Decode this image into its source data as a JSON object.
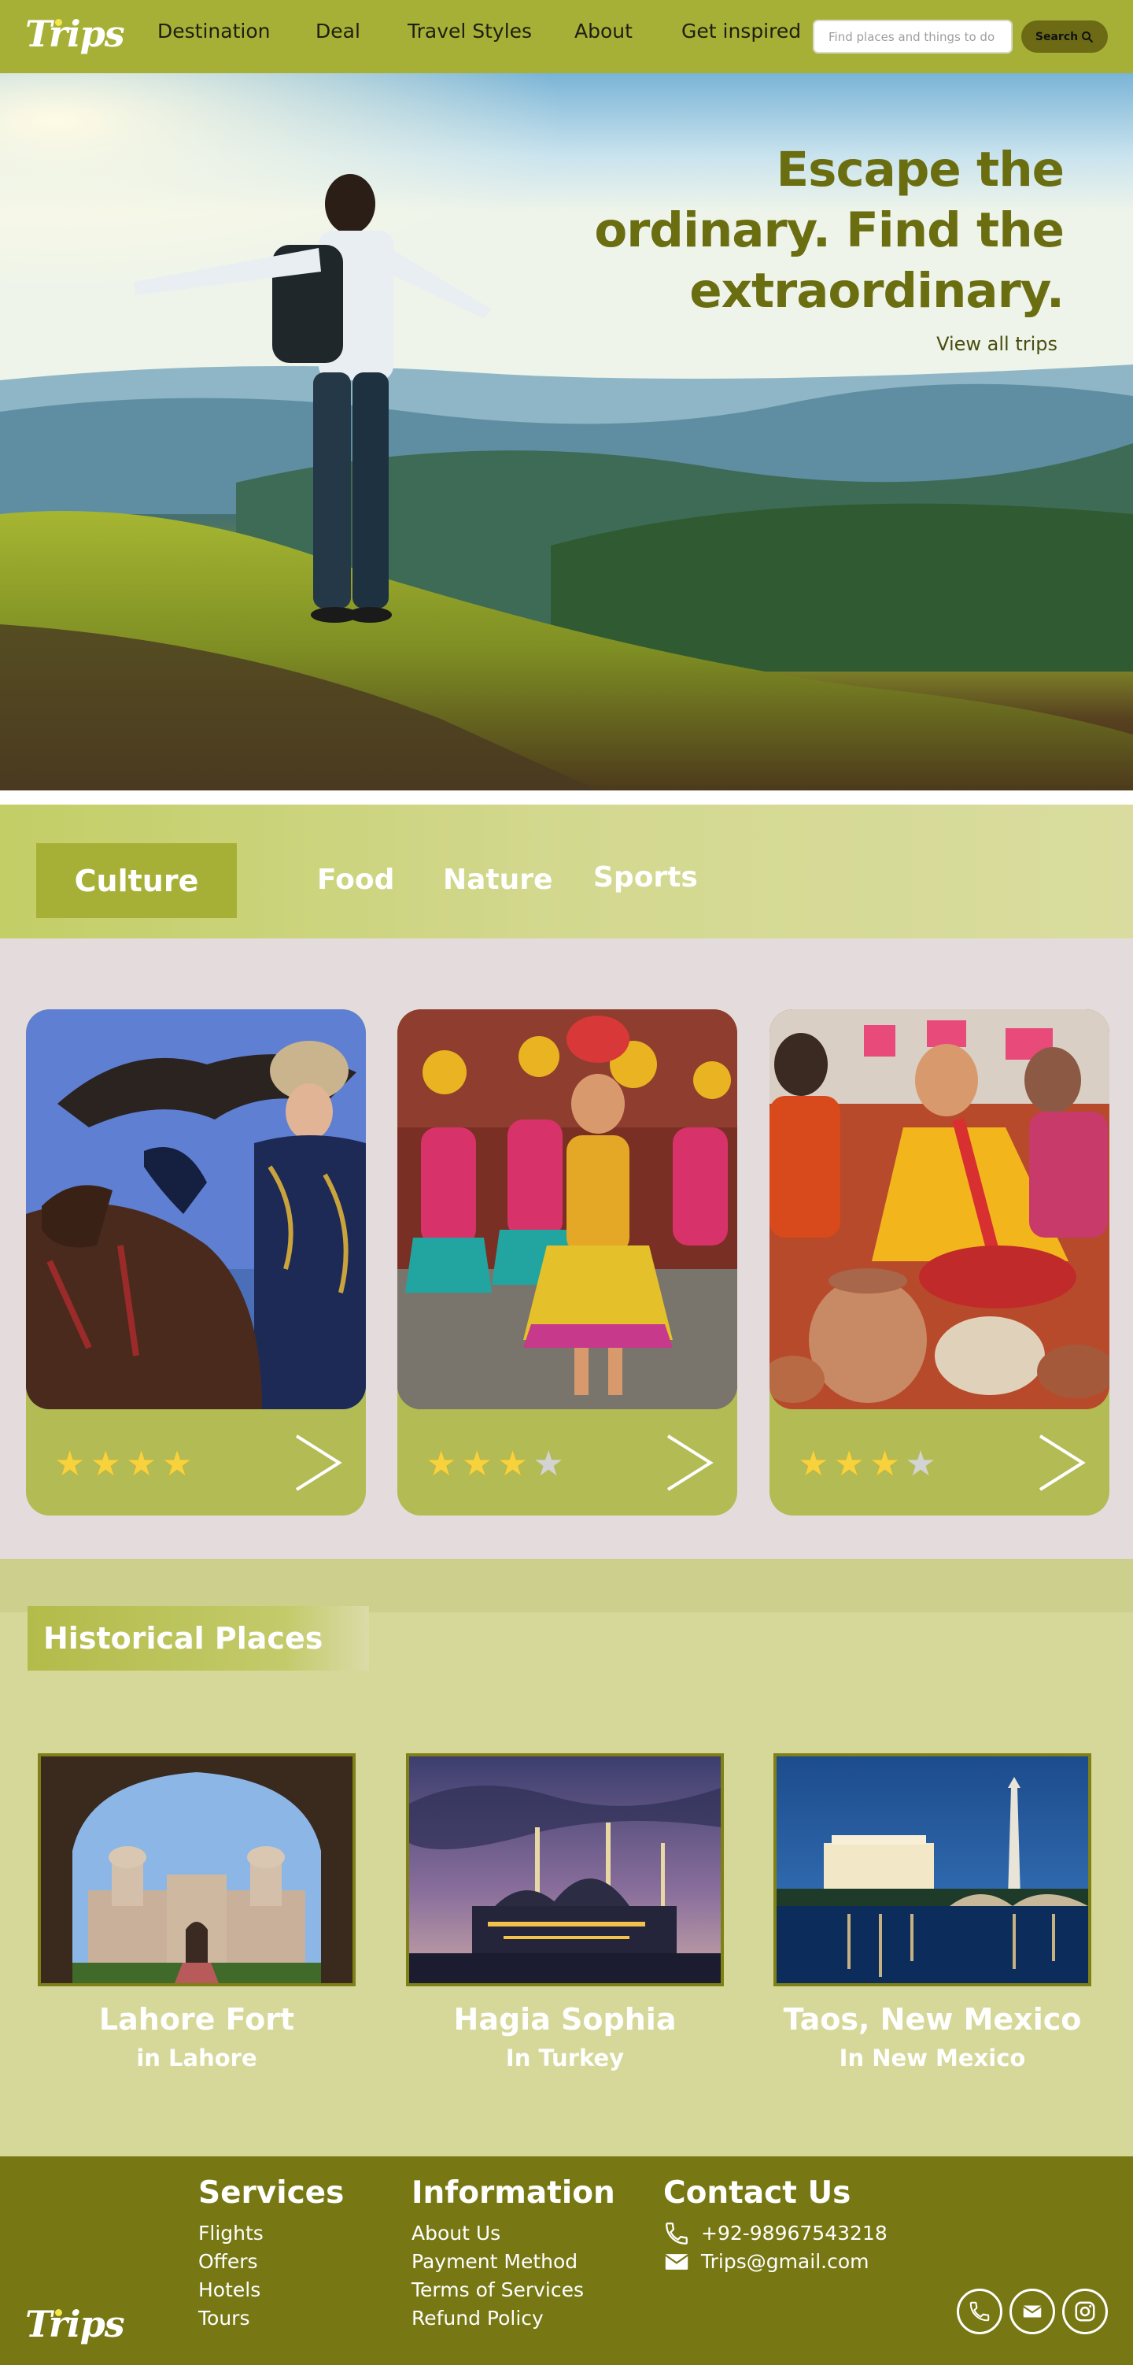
{
  "brand": {
    "name": "Trips"
  },
  "nav": {
    "links": [
      {
        "label": "Destination"
      },
      {
        "label": "Deal"
      },
      {
        "label": "Travel Styles"
      },
      {
        "label": "About"
      },
      {
        "label": "Get inspired"
      }
    ],
    "search_placeholder": "Find places and things to do",
    "search_button": "Search"
  },
  "hero": {
    "title_line1": "Escape the",
    "title_line2": "ordinary. Find the",
    "title_line3": "extraordinary.",
    "link": "View all trips"
  },
  "categories": {
    "tabs": [
      {
        "label": "Culture",
        "active": true
      },
      {
        "label": "Food"
      },
      {
        "label": "Nature"
      },
      {
        "label": "Sports"
      }
    ]
  },
  "culture_cards": [
    {
      "image": "eagle-hunter-on-horseback-photo",
      "rating": 4,
      "max": 4
    },
    {
      "image": "folk-dancers-festival-photo",
      "rating": 3,
      "max": 4
    },
    {
      "image": "women-with-clay-pottery-photo",
      "rating": 3,
      "max": 4
    }
  ],
  "historical": {
    "title": "Historical Places",
    "places": [
      {
        "name": "Lahore Fort",
        "location": "in Lahore",
        "image": "lahore-fort-photo"
      },
      {
        "name": "Hagia Sophia",
        "location": "In Turkey",
        "image": "hagia-sophia-night-photo"
      },
      {
        "name": "Taos, New Mexico",
        "location": "In New Mexico",
        "image": "washington-memorial-night-photo"
      }
    ]
  },
  "footer": {
    "services": {
      "title": "Services",
      "links": [
        "Flights",
        "Offers",
        "Hotels",
        "Tours"
      ]
    },
    "information": {
      "title": "Information",
      "links": [
        "About Us",
        "Payment Method",
        "Terms of Services",
        "Refund Policy"
      ]
    },
    "contact": {
      "title": "Contact Us",
      "phone": "+92-98967543218",
      "email": "Trips@gmail.com"
    },
    "social_icons": [
      "phone-icon",
      "mail-icon",
      "instagram-icon"
    ]
  },
  "colors": {
    "brand_green": "#a7b036",
    "dark_olive": "#777814",
    "card_green": "#b3bb55",
    "hero_title": "#6b6e10",
    "star": "#f7d23c"
  }
}
